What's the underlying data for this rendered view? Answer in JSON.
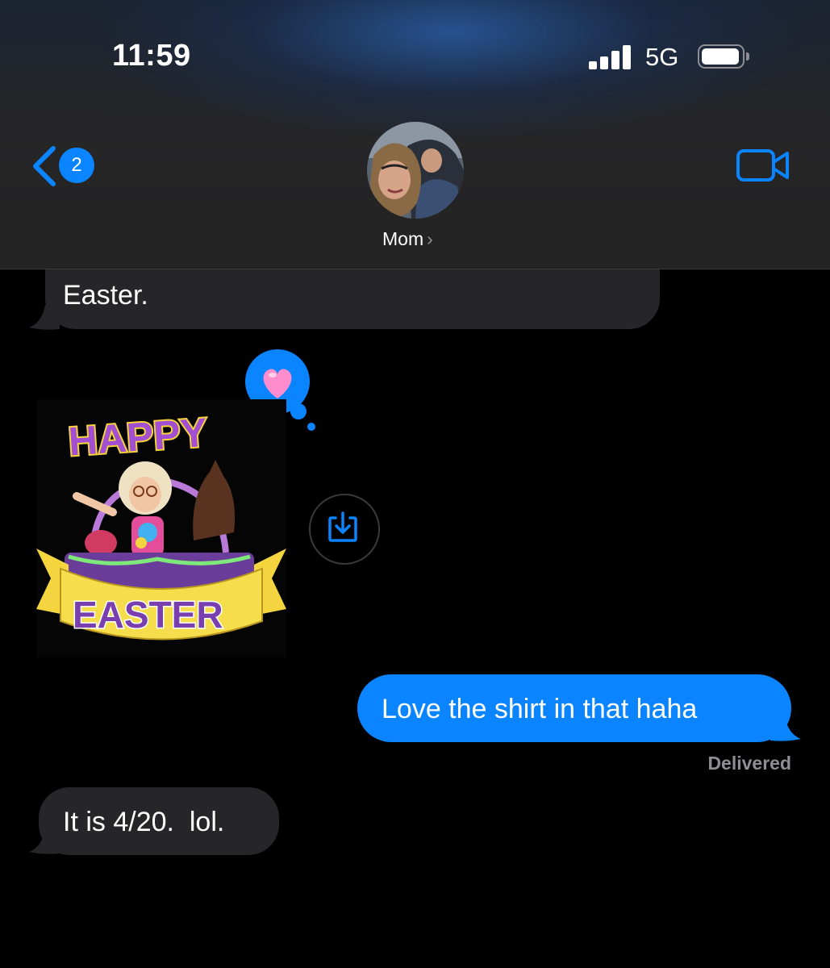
{
  "status_bar": {
    "time": "11:59",
    "network": "5G"
  },
  "nav": {
    "back_badge": "2",
    "contact_name": "Mom",
    "contact_chevron": "›"
  },
  "messages": {
    "first_partial": "Easter.",
    "sticker": {
      "line1": "HAPPY",
      "line2": "EASTER"
    },
    "sent": "Love the shirt in that haha",
    "status": "Delivered",
    "last": "It is 4/20.  lol."
  },
  "icons": {
    "back": "chevron-left-icon",
    "video": "video-camera-icon",
    "save": "save-to-photos-icon",
    "reaction": "heart-tapback-icon"
  },
  "colors": {
    "accent": "#0a84ff",
    "incoming": "#262628",
    "reaction_heart": "#ff8ccd"
  }
}
